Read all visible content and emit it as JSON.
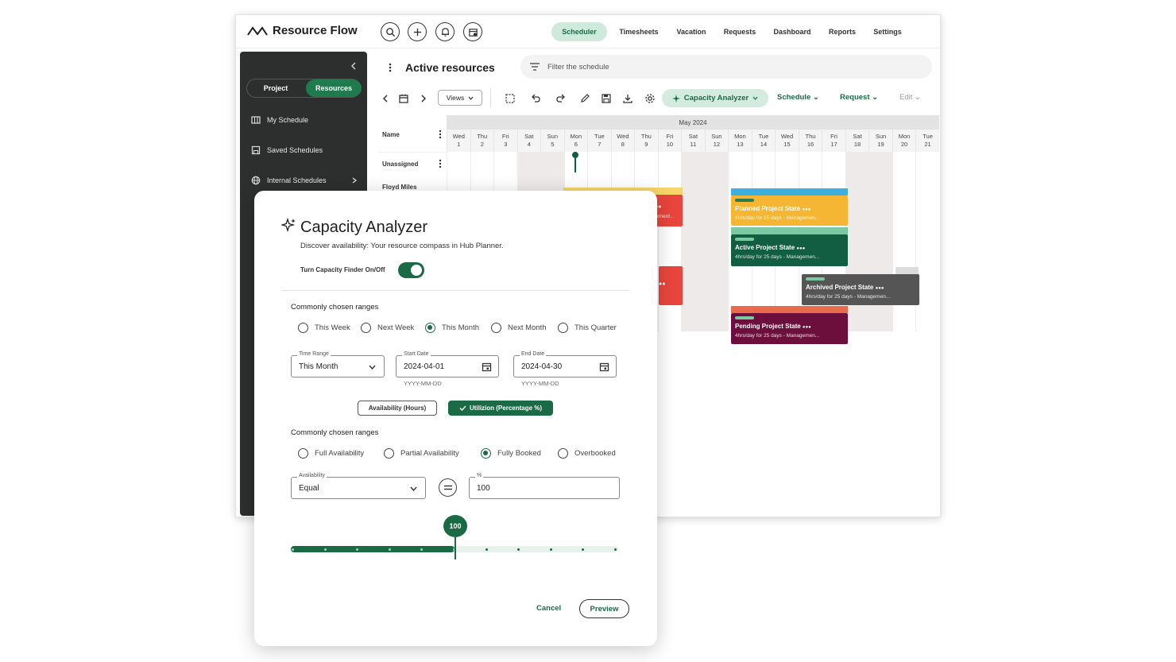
{
  "app": {
    "name": "Resource Flow",
    "nav": [
      "Scheduler",
      "Timesheets",
      "Vacation",
      "Requests",
      "Dashboard",
      "Reports",
      "Settings"
    ],
    "active_nav": "Scheduler"
  },
  "sidebar": {
    "toggle": [
      "Project",
      "Resources"
    ],
    "active_toggle": "Resources",
    "items": [
      {
        "label": "My Schedule",
        "icon": "calendar-grid-icon"
      },
      {
        "label": "Saved Schedules",
        "icon": "save-icon"
      },
      {
        "label": "Internal Schedules",
        "icon": "globe-icon"
      }
    ]
  },
  "main": {
    "title": "Active resources",
    "filter_placeholder": "Filter the schedule",
    "toolbar": {
      "views_label": "Views",
      "capacity_label": "Capacity Analyzer",
      "schedule_label": "Schedule",
      "request_label": "Request",
      "edit_label": "Edit"
    }
  },
  "schedule": {
    "month": "May 2024",
    "name_header": "Name",
    "days": [
      {
        "d": "Wed",
        "n": "1"
      },
      {
        "d": "Thu",
        "n": "2"
      },
      {
        "d": "Fri",
        "n": "3"
      },
      {
        "d": "Sat",
        "n": "4"
      },
      {
        "d": "Sun",
        "n": "5"
      },
      {
        "d": "Mon",
        "n": "6"
      },
      {
        "d": "Tue",
        "n": "7"
      },
      {
        "d": "Wed",
        "n": "8"
      },
      {
        "d": "Thu",
        "n": "9"
      },
      {
        "d": "Fri",
        "n": "10"
      },
      {
        "d": "Sat",
        "n": "11"
      },
      {
        "d": "Sun",
        "n": "12"
      },
      {
        "d": "Mon",
        "n": "13"
      },
      {
        "d": "Tue",
        "n": "14"
      },
      {
        "d": "Wed",
        "n": "15"
      },
      {
        "d": "Thu",
        "n": "16"
      },
      {
        "d": "Fri",
        "n": "17"
      },
      {
        "d": "Sat",
        "n": "18"
      },
      {
        "d": "Sun",
        "n": "19"
      },
      {
        "d": "Mon",
        "n": "20"
      },
      {
        "d": "Tue",
        "n": "21"
      }
    ],
    "rows": [
      "Unassigned",
      "Floyd Miles"
    ],
    "tasks": [
      {
        "title": "Planned Project State",
        "sub": "4hrs/day for 25 days - Managemen...",
        "color": "#f5b733"
      },
      {
        "title": "Active Project State",
        "sub": "4hrs/day for 25 days - Managemen...",
        "color": "#125e43"
      },
      {
        "title": "Archived Project State",
        "sub": "4hrs/day for 25 days - Managemen...",
        "color": "#555555"
      },
      {
        "title": "Pending Project State",
        "sub": "4hrs/day for 25 days - Managemen...",
        "color": "#6d0f3c"
      }
    ],
    "partial_sub": "ement..."
  },
  "modal": {
    "title": "Capacity Analyzer",
    "description": "Discover availability: Your resource compass in Hub Planner.",
    "toggle_label": "Turn Capacity Finder On/Off",
    "section1": "Commonly chosen ranges",
    "ranges": [
      "This Week",
      "Next Week",
      "This Month",
      "Next Month",
      "This Quarter"
    ],
    "selected_range": "This Month",
    "time_range": {
      "label": "Time Range",
      "value": "This Month"
    },
    "start_date": {
      "label": "Start Date",
      "value": "2024-04-01",
      "hint": "YYYY-MM-DD"
    },
    "end_date": {
      "label": "End Date",
      "value": "2024-04-30",
      "hint": "YYYY-MM-DD"
    },
    "mode_availability": "Availability (Hours)",
    "mode_utilization": "Utilizion (Percentage %)",
    "section2": "Commonly chosen ranges",
    "statuses": [
      "Full Availability",
      "Partial Availability",
      "Fully Booked",
      "Overbooked"
    ],
    "selected_status": "Fully Booked",
    "availability": {
      "label": "Availability",
      "value": "Equal"
    },
    "percent": {
      "label": "%",
      "value": "100"
    },
    "slider_value": "100",
    "slider_fraction": 0.5,
    "cancel": "Cancel",
    "preview": "Preview"
  },
  "colors": {
    "accent": "#1a6b45",
    "accent_light": "#d4ecdf",
    "sidebar": "#2d2f2e",
    "red": "#e8453c"
  }
}
